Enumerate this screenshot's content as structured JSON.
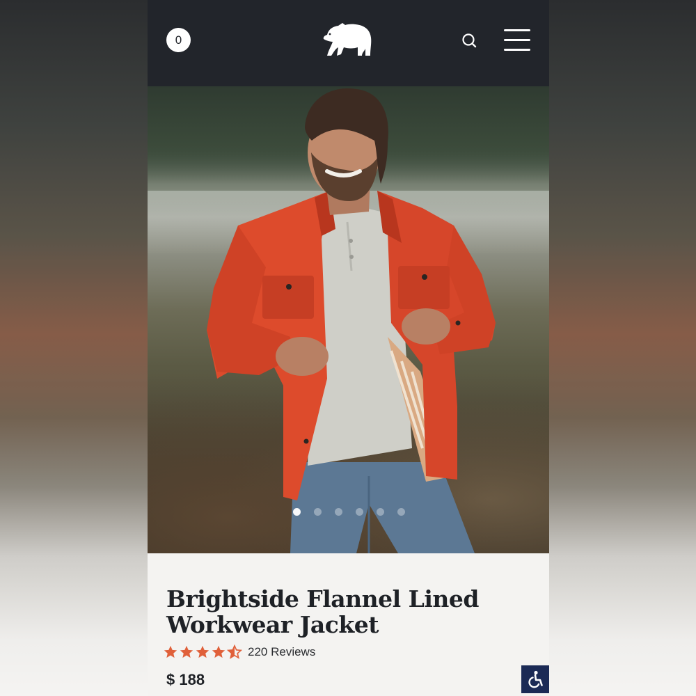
{
  "header": {
    "cart_count": "0",
    "logo_icon": "bear-logo-icon",
    "search_icon": "search-icon",
    "menu_icon": "hamburger-menu-icon",
    "background_color": "#22252b"
  },
  "hero": {
    "carousel": {
      "total_slides": 6,
      "active_index": 0
    }
  },
  "product": {
    "title_line1": "Brightside Flannel Lined",
    "title_line2": "Workwear Jacket",
    "rating": 4.5,
    "reviews_label": "220 Reviews",
    "price": "$ 188",
    "star_color": "#e0603a"
  },
  "accessibility": {
    "icon": "wheelchair-accessibility-icon",
    "background_color": "#1b2a55"
  }
}
